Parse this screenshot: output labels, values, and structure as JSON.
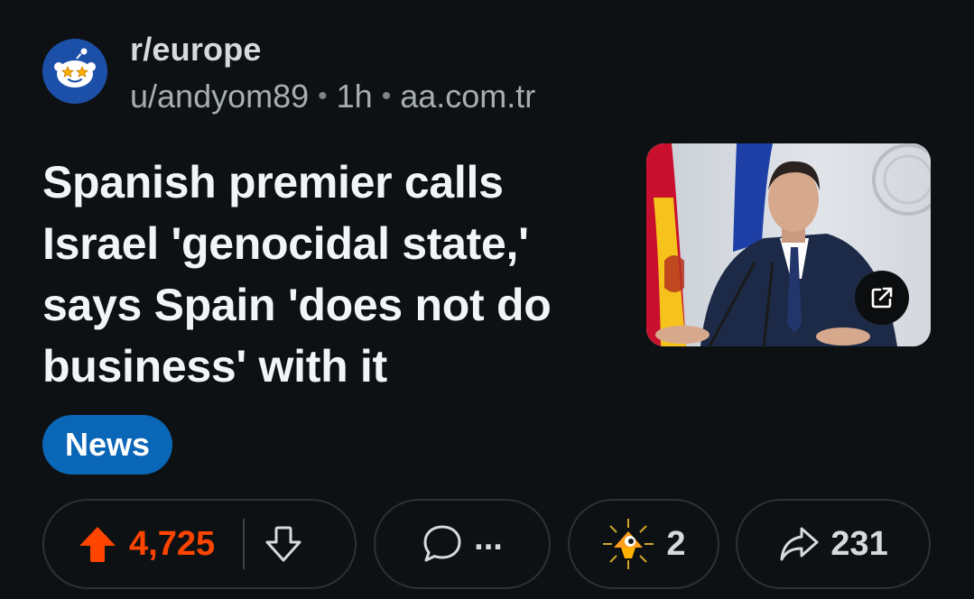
{
  "post": {
    "subreddit": "r/europe",
    "author": "u/andyom89",
    "separator": "•",
    "age": "1h",
    "domain": "aa.com.tr",
    "title": "Spanish premier calls Israel 'genocidal state,' says Spain 'does not do business' with it",
    "flair": "News",
    "flair_color": "#0a66b7"
  },
  "actions": {
    "upvote_icon": "upvote-arrow-icon",
    "score": "4,725",
    "score_color": "#ff4500",
    "downvote_icon": "downvote-arrow-icon",
    "comment_icon": "comment-bubble-icon",
    "comments": "...",
    "award_icon": "award-icon",
    "awards": "2",
    "share_icon": "share-arrow-icon",
    "shares": "231"
  },
  "thumbnail": {
    "external_link_icon": "external-link-icon"
  }
}
